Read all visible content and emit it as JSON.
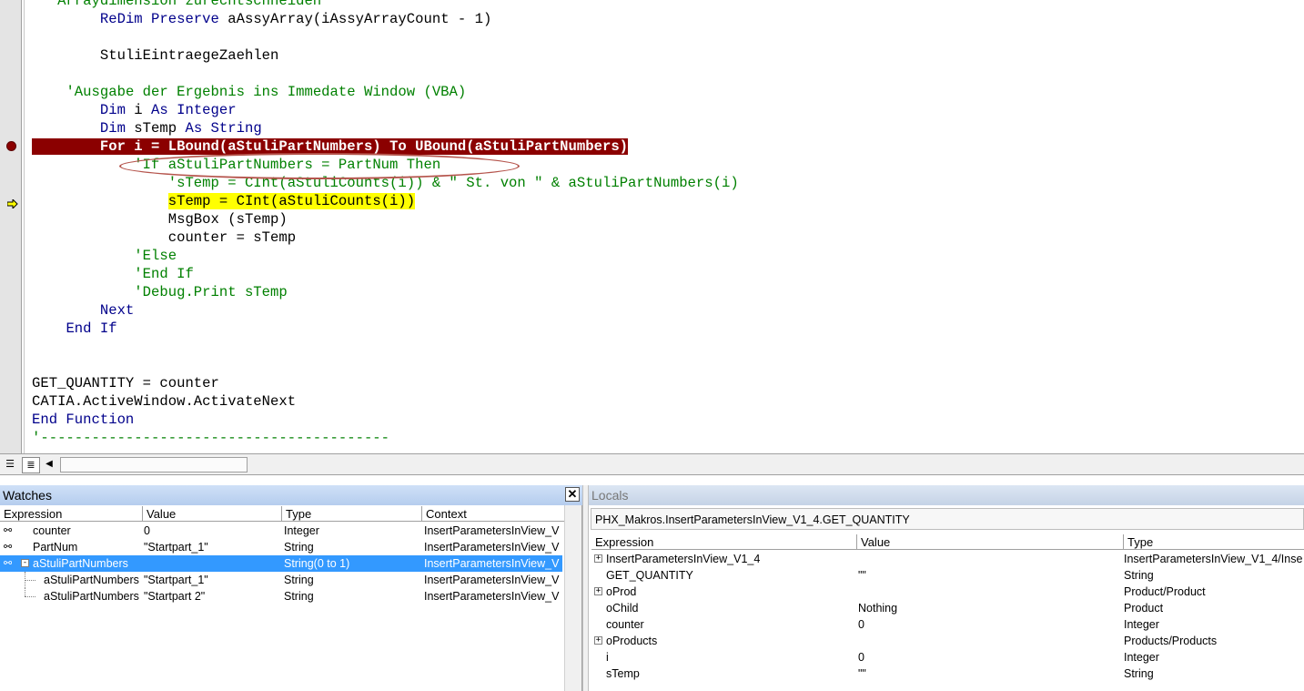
{
  "editor": {
    "code_lines": [
      {
        "indent": "  ",
        "parts": [
          {
            "t": "'Arraydimension zurechtschneiden",
            "c": "cm"
          }
        ]
      },
      {
        "indent": "        ",
        "parts": [
          {
            "t": "ReDim Preserve",
            "c": "kw"
          },
          {
            "t": " aAssyArray(iAssyArrayCount - 1)",
            "c": ""
          }
        ]
      },
      {
        "indent": "",
        "parts": []
      },
      {
        "indent": "        ",
        "parts": [
          {
            "t": "StuliEintraegeZaehlen",
            "c": ""
          }
        ]
      },
      {
        "indent": "",
        "parts": []
      },
      {
        "indent": "    ",
        "parts": [
          {
            "t": "'Ausgabe der Ergebnis ins Immedate Window (VBA)",
            "c": "cm"
          }
        ]
      },
      {
        "indent": "        ",
        "parts": [
          {
            "t": "Dim",
            "c": "kw"
          },
          {
            "t": " i ",
            "c": ""
          },
          {
            "t": "As Integer",
            "c": "kw"
          }
        ]
      },
      {
        "indent": "        ",
        "parts": [
          {
            "t": "Dim",
            "c": "kw"
          },
          {
            "t": " sTemp ",
            "c": ""
          },
          {
            "t": "As String",
            "c": "kw"
          }
        ]
      },
      {
        "indent": "",
        "parts": [
          {
            "t": "        For i = LBound(aStuliPartNumbers) To UBound(aStuliPartNumbers)",
            "c": "bp"
          }
        ],
        "marker": "breakpoint"
      },
      {
        "indent": "            ",
        "parts": [
          {
            "t": "'If aStuliPartNumbers = PartNum Then",
            "c": "cm"
          }
        ]
      },
      {
        "indent": "                ",
        "parts": [
          {
            "t": "'sTemp = CInt(aStuliCounts(i)) & \" St. von \" & aStuliPartNumbers(i)",
            "c": "cm"
          }
        ]
      },
      {
        "indent": "                ",
        "parts": [
          {
            "t": "sTemp = CInt(aStuliCounts(i))",
            "c": "ex"
          }
        ],
        "marker": "execution"
      },
      {
        "indent": "                ",
        "parts": [
          {
            "t": "MsgBox (sTemp)",
            "c": ""
          }
        ]
      },
      {
        "indent": "                ",
        "parts": [
          {
            "t": "counter = sTemp",
            "c": ""
          }
        ]
      },
      {
        "indent": "            ",
        "parts": [
          {
            "t": "'Else",
            "c": "cm"
          }
        ]
      },
      {
        "indent": "            ",
        "parts": [
          {
            "t": "'End If",
            "c": "cm"
          }
        ]
      },
      {
        "indent": "            ",
        "parts": [
          {
            "t": "'Debug.Print sTemp",
            "c": "cm"
          }
        ]
      },
      {
        "indent": "        ",
        "parts": [
          {
            "t": "Next",
            "c": "kw"
          }
        ]
      },
      {
        "indent": "    ",
        "parts": [
          {
            "t": "End If",
            "c": "kw"
          }
        ]
      },
      {
        "indent": "",
        "parts": []
      },
      {
        "indent": "",
        "parts": []
      },
      {
        "indent": "",
        "parts": [
          {
            "t": "GET_QUANTITY = counter",
            "c": ""
          }
        ]
      },
      {
        "indent": "",
        "parts": [
          {
            "t": "CATIA.ActiveWindow.ActivateNext",
            "c": ""
          }
        ]
      },
      {
        "indent": "",
        "parts": [
          {
            "t": "End Function",
            "c": "kw"
          }
        ]
      },
      {
        "indent": "",
        "parts": [
          {
            "t": "'-----------------------------------------",
            "c": "cm"
          }
        ]
      }
    ],
    "colors": {
      "keyword": "#00008b",
      "comment": "#008000",
      "breakpoint": "#8b0000",
      "execution": "#ffff00"
    }
  },
  "toolbar": {
    "procedure_view_icon": "procedure-view-icon",
    "full_module_view_icon": "full-module-view-icon"
  },
  "watches": {
    "title": "Watches",
    "close_label": "✕",
    "columns": [
      "Expression",
      "Value",
      "Type",
      "Context"
    ],
    "rows": [
      {
        "expression": "counter",
        "value": "0",
        "type": "Integer",
        "context": "InsertParametersInView_V",
        "level": 0,
        "icon": "watch-glasses-icon",
        "selected": false
      },
      {
        "expression": "PartNum",
        "value": "\"Startpart_1\"",
        "type": "String",
        "context": "InsertParametersInView_V",
        "level": 0,
        "icon": "watch-glasses-icon",
        "selected": false
      },
      {
        "expression": "aStuliPartNumbers",
        "value": "",
        "type": "String(0 to 1)",
        "context": "InsertParametersInView_V",
        "level": 0,
        "icon": "watch-glasses-icon",
        "expander": "-",
        "selected": true
      },
      {
        "expression": "aStuliPartNumbers",
        "value": "\"Startpart_1\"",
        "type": "String",
        "context": "InsertParametersInView_V",
        "level": 1,
        "selected": false
      },
      {
        "expression": "aStuliPartNumbers",
        "value": "\"Startpart 2\"",
        "type": "String",
        "context": "InsertParametersInView_V",
        "level": 1,
        "selected": false
      }
    ]
  },
  "locals": {
    "title": "Locals",
    "context": "PHX_Makros.InsertParametersInView_V1_4.GET_QUANTITY",
    "columns": [
      "Expression",
      "Value",
      "Type"
    ],
    "rows": [
      {
        "expression": "InsertParametersInView_V1_4",
        "value": "",
        "type": "InsertParametersInView_V1_4/Inse",
        "expander": "+"
      },
      {
        "expression": "GET_QUANTITY",
        "value": "\"\"",
        "type": "String"
      },
      {
        "expression": "oProd",
        "value": "",
        "type": "Product/Product",
        "expander": "+"
      },
      {
        "expression": "oChild",
        "value": "Nothing",
        "type": "Product"
      },
      {
        "expression": "counter",
        "value": "0",
        "type": "Integer"
      },
      {
        "expression": "oProducts",
        "value": "",
        "type": "Products/Products",
        "expander": "+"
      },
      {
        "expression": "i",
        "value": "0",
        "type": "Integer"
      },
      {
        "expression": "sTemp",
        "value": "\"\"",
        "type": "String"
      }
    ]
  }
}
